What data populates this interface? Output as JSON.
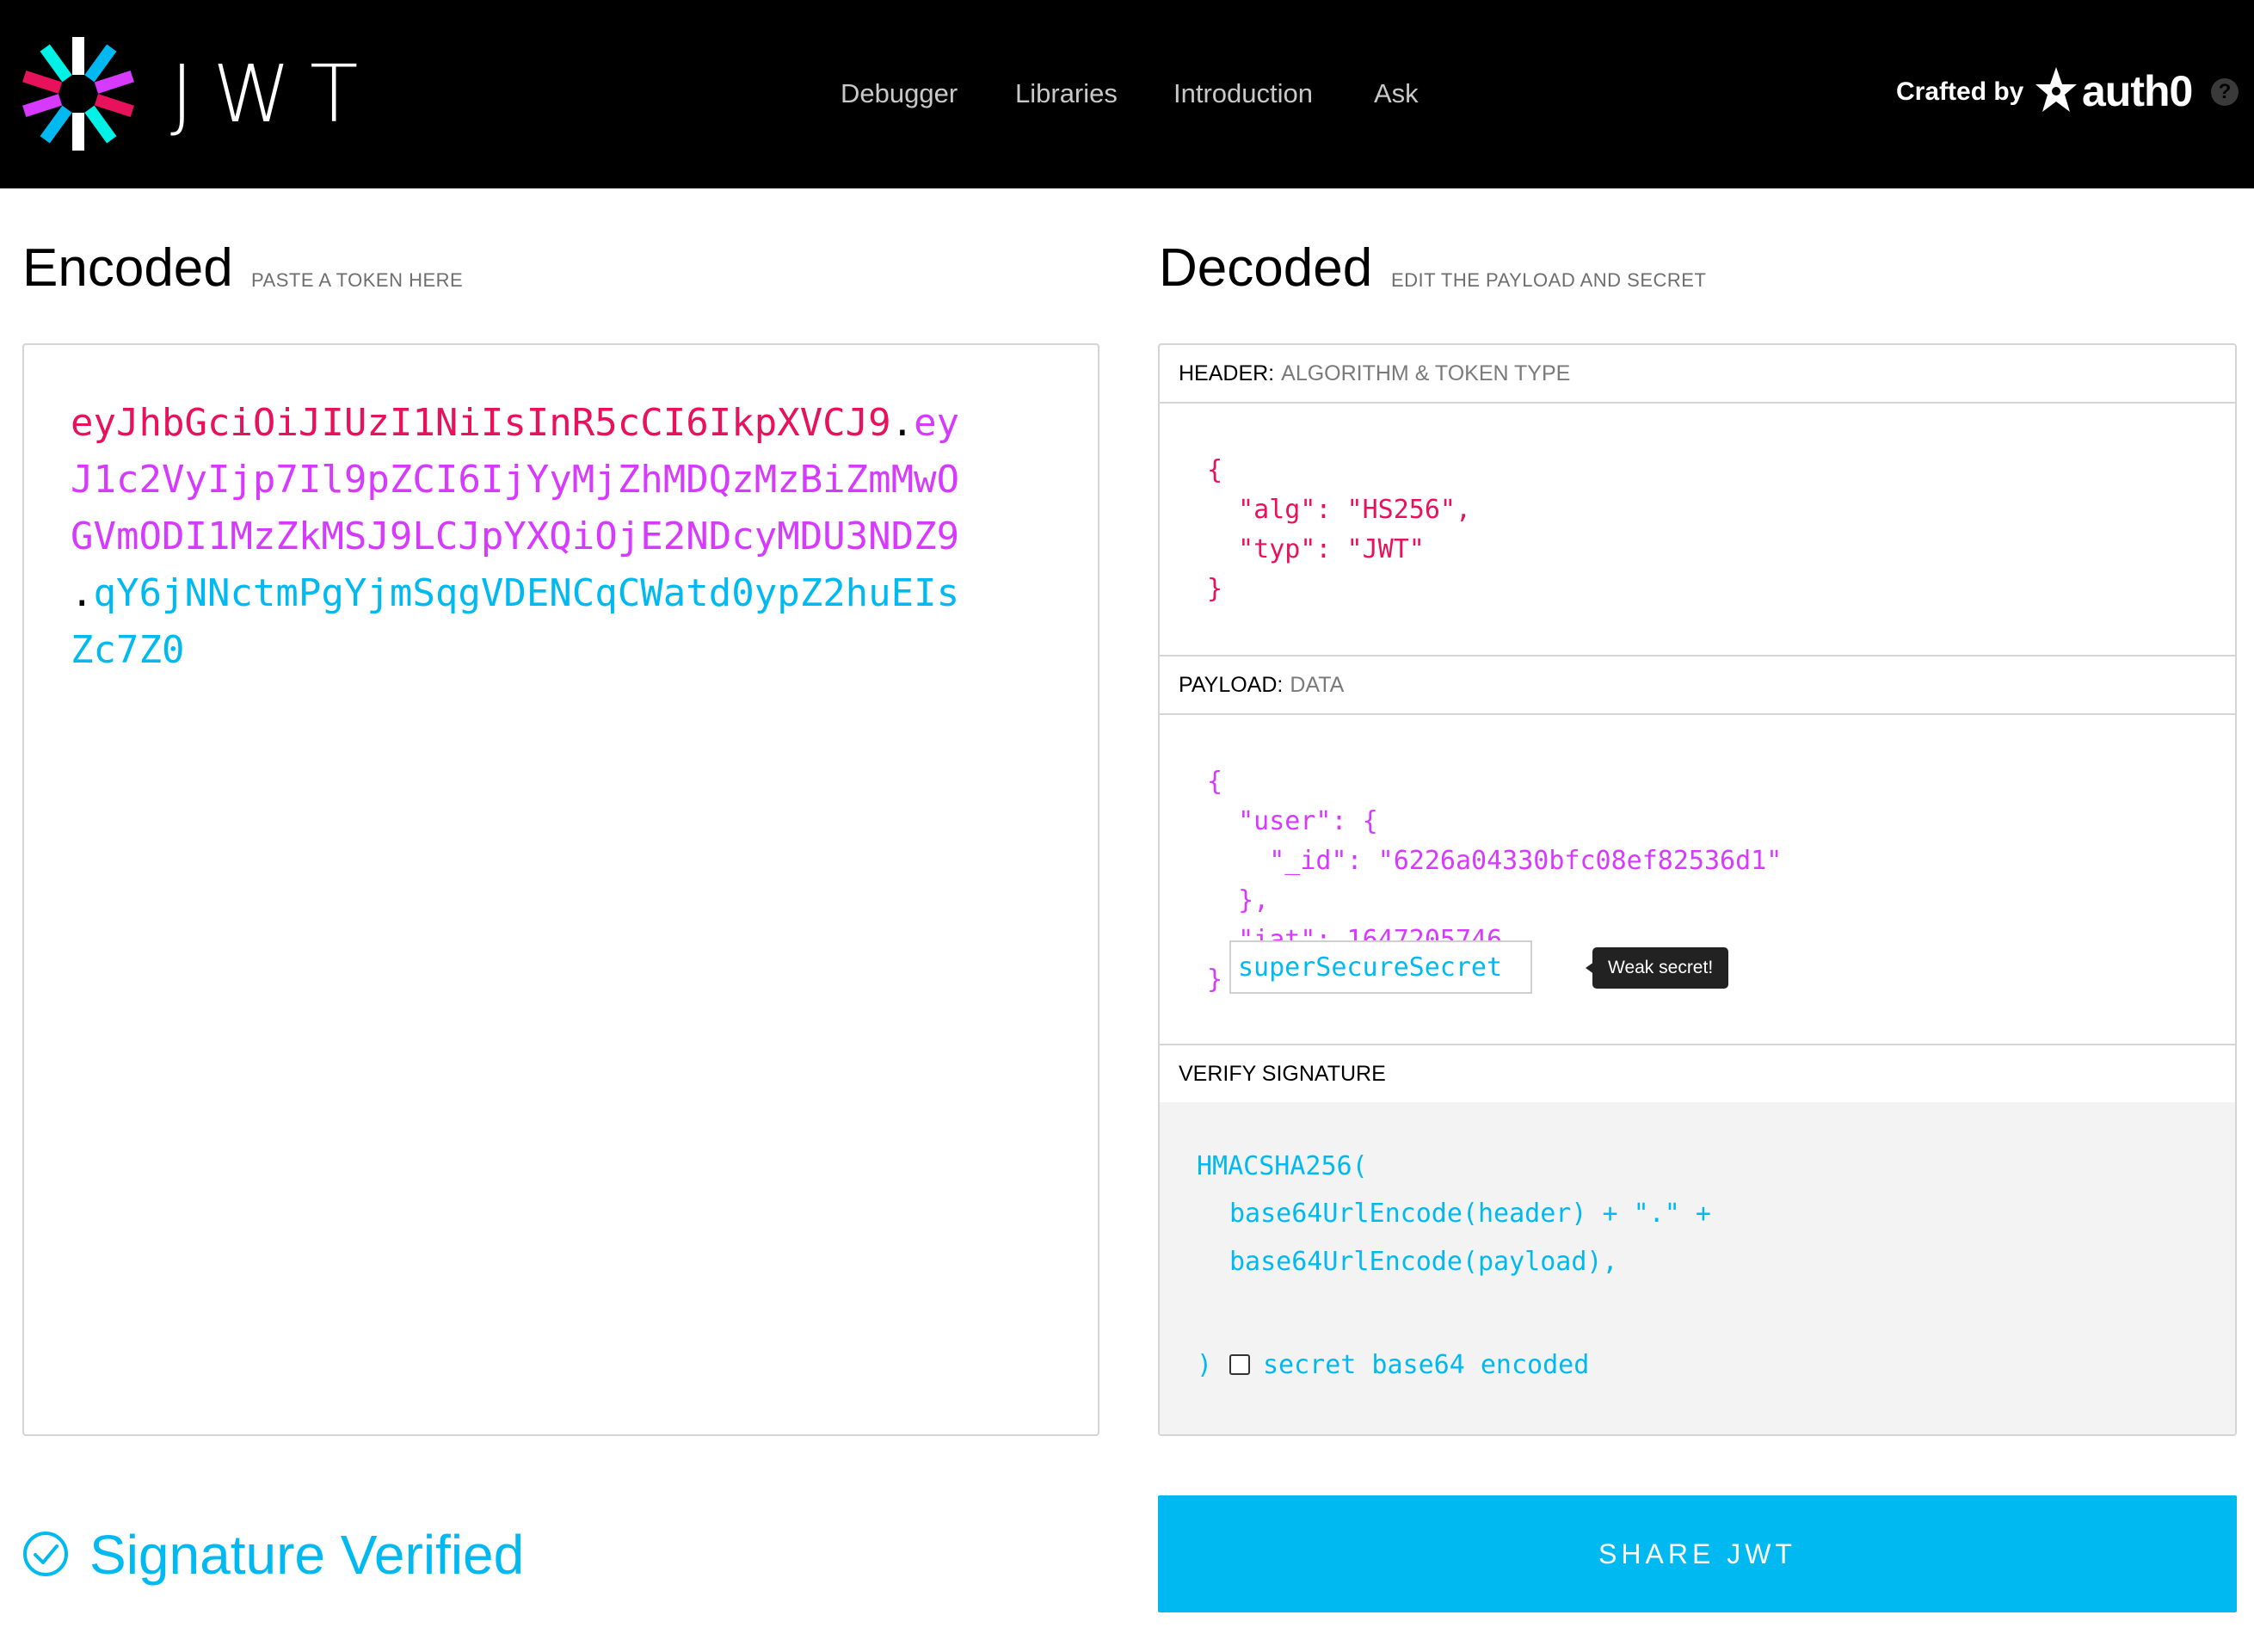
{
  "header": {
    "logo_text": "JWT",
    "nav": [
      "Debugger",
      "Libraries",
      "Introduction",
      "Ask"
    ],
    "crafted_by": "Crafted by",
    "brand": "auth0",
    "help_label": "?",
    "icons": {
      "logo": "jwt-logo-icon",
      "brand": "auth0-shield-icon",
      "help": "help-icon"
    }
  },
  "encoded": {
    "title": "Encoded",
    "subtitle": "PASTE A TOKEN HERE",
    "token_lines": [
      {
        "part1": "eyJhbGciOiJIUzI1NiIsInR5cCI6IkpXVCJ9",
        "dot": ".",
        "part2": "ey"
      },
      {
        "text": "J1c2VyIjp7Il9pZCI6IjYyMjZhMDQzMzBiZmMwO"
      },
      {
        "text": "GVmODI1MzZkMSJ9LCJpYXQiOjE2NDcyMDU3NDZ9"
      },
      {
        "dot": ".",
        "part3": "qY6jNNctmPgYjmSqgVDENCqCWatd0ypZ2huEIs"
      },
      {
        "text": "Zc7Z0"
      }
    ]
  },
  "decoded": {
    "title": "Decoded",
    "subtitle": "EDIT THE PAYLOAD AND SECRET",
    "header_section": {
      "label": "HEADER:",
      "desc": "ALGORITHM & TOKEN TYPE",
      "lines": [
        "{",
        "  \"alg\": \"HS256\",",
        "  \"typ\": \"JWT\"",
        "}"
      ]
    },
    "payload_section": {
      "label": "PAYLOAD:",
      "desc": "DATA",
      "lines": [
        "{",
        "  \"user\": {",
        "    \"_id\": \"6226a04330bfc08ef82536d1\"",
        "  },",
        "  \"iat\": 1647205746",
        "}"
      ]
    },
    "verify_section": {
      "label": "VERIFY SIGNATURE",
      "fn": "HMACSHA256(",
      "arg1": "base64UrlEncode(header) + \".\" +",
      "arg2": "base64UrlEncode(payload),",
      "secret": "superSecureSecret",
      "tooltip": "Weak secret!",
      "close": ")",
      "checkbox_label": "secret base64 encoded",
      "checkbox_checked": false
    }
  },
  "status": {
    "text": "Signature Verified",
    "icon": "check-circle-icon"
  },
  "share_button": "SHARE JWT",
  "colors": {
    "header_part": "#e8115b",
    "payload_part": "#d63aff",
    "signature_part": "#00b9f1",
    "accent": "#00b9f1",
    "topbar": "#000000"
  }
}
